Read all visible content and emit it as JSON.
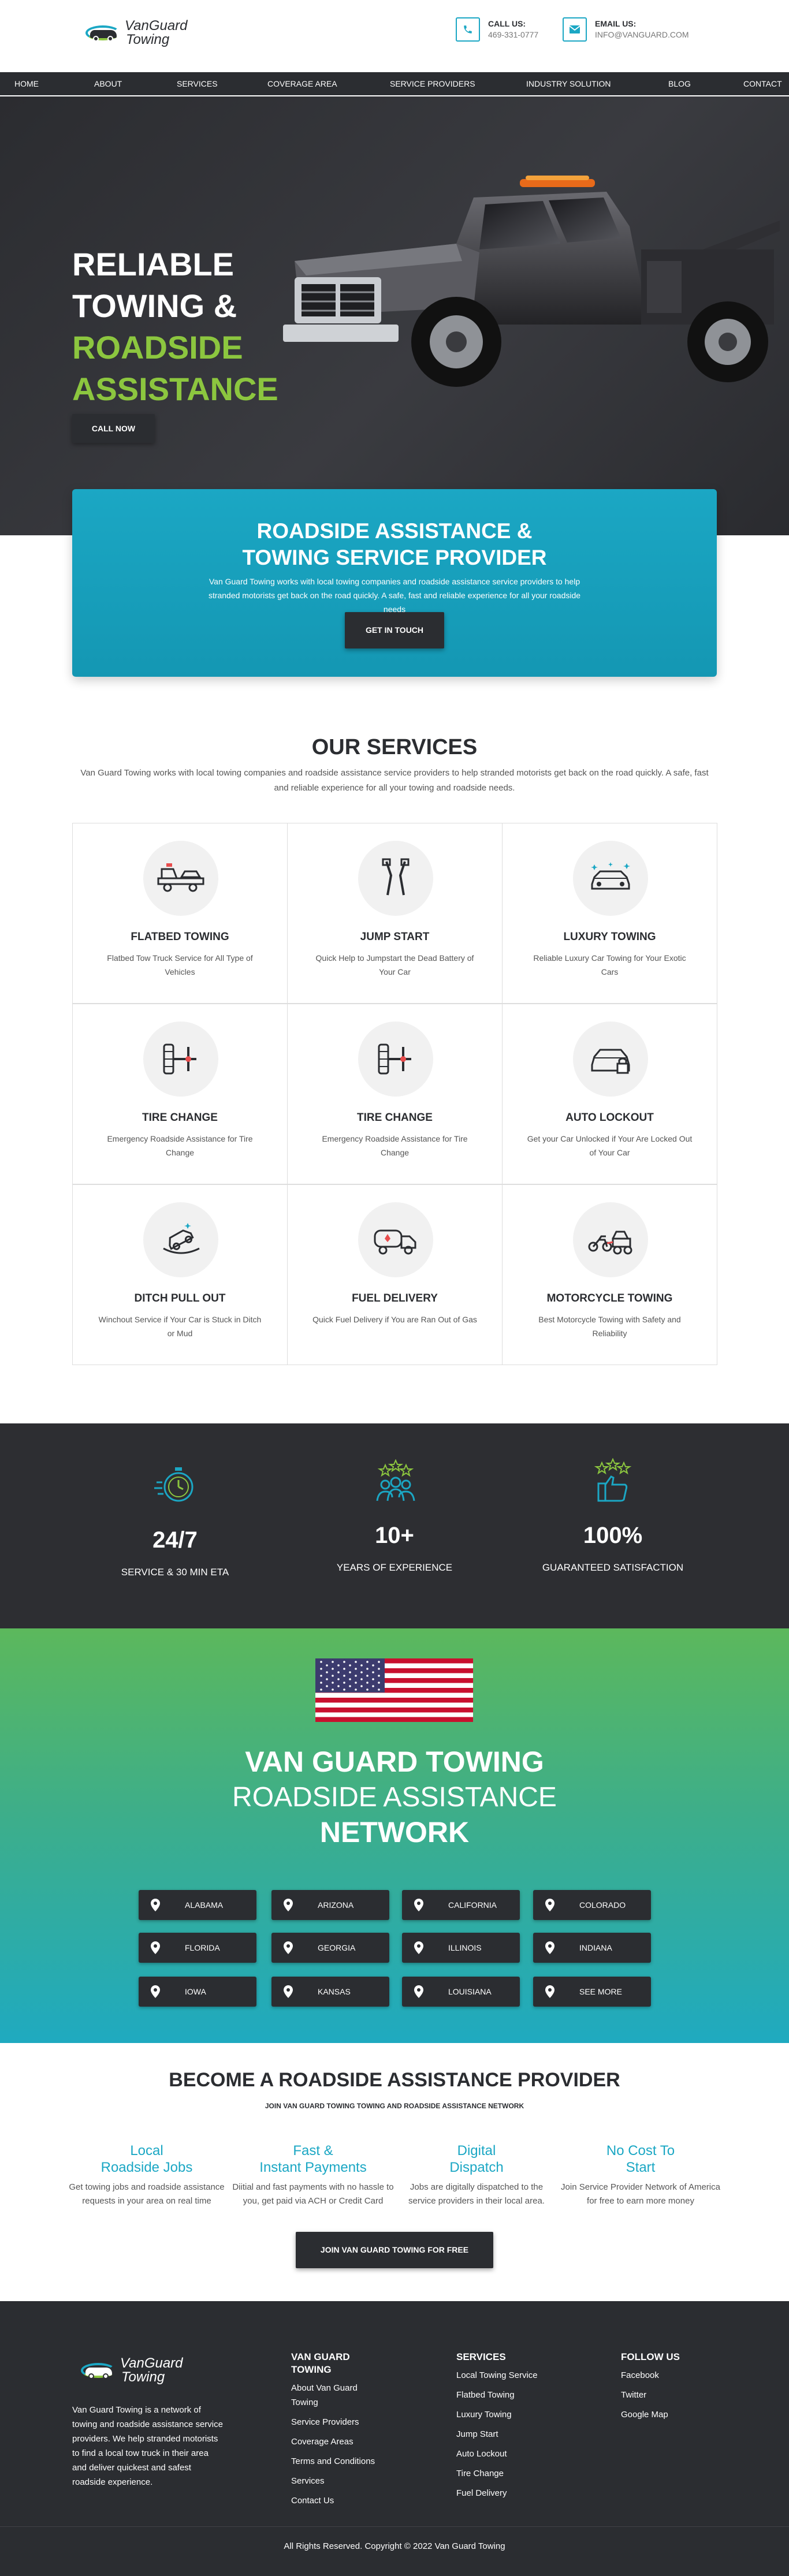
{
  "header": {
    "logo_text_1": "VanGuard",
    "logo_text_2": "Towing",
    "call_label": "CALL US:",
    "call_value": "469-331-0777",
    "email_label": "EMAIL US:",
    "email_value": "INFO@VANGUARD.COM"
  },
  "nav": [
    "HOME",
    "ABOUT",
    "SERVICES",
    "COVERAGE AREA",
    "SERVICE PROVIDERS",
    "INDUSTRY SOLUTION",
    "BLOG",
    "CONTACT"
  ],
  "hero": {
    "line1": "RELIABLE",
    "line2": "TOWING &",
    "line3": "ROADSIDE",
    "line4": "ASSISTANCE",
    "button": "CALL NOW"
  },
  "cta": {
    "title_1": "ROADSIDE ASSISTANCE &",
    "title_2": "TOWING SERVICE PROVIDER",
    "text": "Van Guard Towing works with local towing companies and roadside assistance service providers to help stranded motorists get back on the road quickly. A safe, fast and reliable experience for all your roadside needs",
    "button": "GET IN TOUCH"
  },
  "services": {
    "title": "OUR SERVICES",
    "subtitle": "Van Guard Towing works with local towing companies and roadside assistance service providers to help stranded motorists get back on the road quickly. A safe, fast and reliable experience for all your towing and roadside needs.",
    "items": [
      {
        "title": "FLATBED TOWING",
        "desc": "Flatbed Tow Truck Service for All Type of Vehicles",
        "icon": "flatbed-truck-icon"
      },
      {
        "title": "JUMP START",
        "desc": "Quick Help to Jumpstart the Dead Battery of Your Car",
        "icon": "jumper-cables-icon"
      },
      {
        "title": "LUXURY TOWING",
        "desc": "Reliable Luxury Car Towing for Your Exotic Cars",
        "icon": "luxury-car-icon"
      },
      {
        "title": "TIRE CHANGE",
        "desc": "Emergency Roadside Assistance for Tire Change",
        "icon": "tire-wrench-icon"
      },
      {
        "title": "TIRE CHANGE",
        "desc": "Emergency Roadside Assistance for Tire Change",
        "icon": "tire-wrench-icon"
      },
      {
        "title": "AUTO LOCKOUT",
        "desc": "Get your Car Unlocked if Your Are Locked Out of Your Car",
        "icon": "car-lock-icon"
      },
      {
        "title": "DITCH PULL OUT",
        "desc": "Winchout Service if Your Car is Stuck in Ditch or Mud",
        "icon": "car-ditch-icon"
      },
      {
        "title": "FUEL DELIVERY",
        "desc": "Quick Fuel Delivery if You are Ran Out of Gas",
        "icon": "fuel-truck-icon"
      },
      {
        "title": "MOTORCYCLE TOWING",
        "desc": "Best Motorcycle Towing with Safety and Reliability",
        "icon": "motorcycle-tow-icon"
      }
    ]
  },
  "stats": [
    {
      "number": "24/7",
      "label": "SERVICE & 30 MIN ETA",
      "icon": "stopwatch-icon"
    },
    {
      "number": "10+",
      "label": "YEARS OF EXPERIENCE",
      "icon": "team-stars-icon"
    },
    {
      "number": "100%",
      "label": "GUARANTEED SATISFACTION",
      "icon": "thumbs-up-stars-icon"
    }
  ],
  "network": {
    "title_1": "VAN GUARD TOWING",
    "title_2": "ROADSIDE ASSISTANCE",
    "title_3": "NETWORK",
    "states": [
      "ALABAMA",
      "ARIZONA",
      "CALIFORNIA",
      "COLORADO",
      "FLORIDA",
      "GEORGIA",
      "ILLINOIS",
      "INDIANA",
      "IOWA",
      "KANSAS",
      "LOUISIANA",
      "SEE MORE"
    ]
  },
  "become": {
    "title": "BECOME A ROADSIDE ASSISTANCE PROVIDER",
    "subtitle": "JOIN VAN GUARD TOWING TOWING AND ROADSIDE ASSISTANCE NETWORK",
    "cols": [
      {
        "h1": "Local",
        "h2": "Roadside Jobs",
        "text": "Get towing jobs and roadside assistance requests in your area on real time"
      },
      {
        "h1": "Fast &",
        "h2": "Instant Payments",
        "text": "Diitial and fast payments with no hassle to you, get paid via ACH or Credit Card"
      },
      {
        "h1": "Digital",
        "h2": "Dispatch",
        "text": "Jobs are digitally dispatched to the service providers in their local area."
      },
      {
        "h1": "No Cost To",
        "h2": "Start",
        "text": "Join Service Provider Network of America for free to earn more money"
      }
    ],
    "button": "JOIN VAN GUARD TOWING FOR FREE"
  },
  "footer": {
    "about": "Van Guard Towing is a network of towing and roadside assistance service providers. We help stranded motorists to find a local tow truck in their area and deliver quickest and safest roadside experience.",
    "col1_title": "VAN GUARD TOWING",
    "col1_links": [
      "About Van Guard Towing",
      "Service Providers",
      "Coverage Areas",
      "Terms and Conditions",
      "Services",
      "Contact Us"
    ],
    "col2_title": "SERVICES",
    "col2_links": [
      "Local Towing Service",
      "Flatbed Towing",
      "Luxury Towing",
      "Jump Start",
      "Auto Lockout",
      "Tire Change",
      "Fuel Delivery"
    ],
    "col3_title": "FOLLOW US",
    "col3_links": [
      "Facebook",
      "Twitter",
      "Google Map"
    ],
    "copyright": "All Rights Reserved. Copyright © 2022 Van Guard Towing"
  },
  "colors": {
    "accent": "#1ba7c4",
    "green": "#8cc63f",
    "dark": "#2b2d31"
  }
}
